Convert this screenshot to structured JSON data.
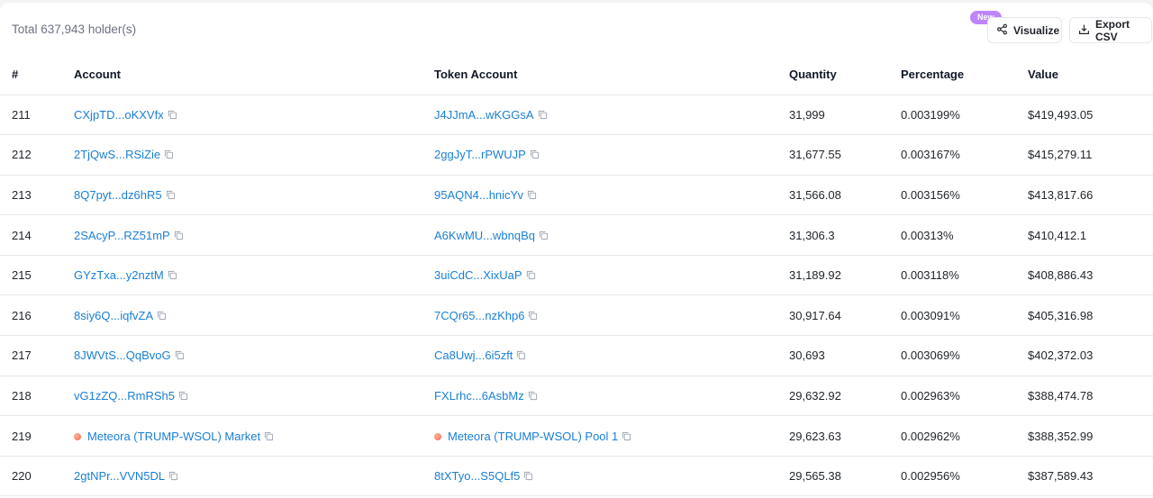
{
  "header": {
    "total_label": "Total 637,943 holder(s)",
    "new_badge": "New",
    "visualize_label": "Visualize",
    "export_label": "Export CSV"
  },
  "table": {
    "columns": [
      "#",
      "Account",
      "Token Account",
      "Quantity",
      "Percentage",
      "Value"
    ],
    "rows": [
      {
        "idx": "211",
        "account": "CXjpTD...oKXVfx",
        "account_protocol": false,
        "token": "J4JJmA...wKGGsA",
        "token_protocol": false,
        "qty": "31,999",
        "pct": "0.003199%",
        "value": "$419,493.05"
      },
      {
        "idx": "212",
        "account": "2TjQwS...RSiZie",
        "account_protocol": false,
        "token": "2ggJyT...rPWUJP",
        "token_protocol": false,
        "qty": "31,677.55",
        "pct": "0.003167%",
        "value": "$415,279.11"
      },
      {
        "idx": "213",
        "account": "8Q7pyt...dz6hR5",
        "account_protocol": false,
        "token": "95AQN4...hnicYv",
        "token_protocol": false,
        "qty": "31,566.08",
        "pct": "0.003156%",
        "value": "$413,817.66"
      },
      {
        "idx": "214",
        "account": "2SAcyP...RZ51mP",
        "account_protocol": false,
        "token": "A6KwMU...wbnqBq",
        "token_protocol": false,
        "qty": "31,306.3",
        "pct": "0.00313%",
        "value": "$410,412.1"
      },
      {
        "idx": "215",
        "account": "GYzTxa...y2nztM",
        "account_protocol": false,
        "token": "3uiCdC...XixUaP",
        "token_protocol": false,
        "qty": "31,189.92",
        "pct": "0.003118%",
        "value": "$408,886.43"
      },
      {
        "idx": "216",
        "account": "8siy6Q...iqfvZA",
        "account_protocol": false,
        "token": "7CQr65...nzKhp6",
        "token_protocol": false,
        "qty": "30,917.64",
        "pct": "0.003091%",
        "value": "$405,316.98"
      },
      {
        "idx": "217",
        "account": "8JWVtS...QqBvoG",
        "account_protocol": false,
        "token": "Ca8Uwj...6i5zft",
        "token_protocol": false,
        "qty": "30,693",
        "pct": "0.003069%",
        "value": "$402,372.03"
      },
      {
        "idx": "218",
        "account": "vG1zZQ...RmRSh5",
        "account_protocol": false,
        "token": "FXLrhc...6AsbMz",
        "token_protocol": false,
        "qty": "29,632.92",
        "pct": "0.002963%",
        "value": "$388,474.78"
      },
      {
        "idx": "219",
        "account": "Meteora (TRUMP-WSOL) Market",
        "account_protocol": true,
        "token": "Meteora (TRUMP-WSOL) Pool 1",
        "token_protocol": true,
        "qty": "29,623.63",
        "pct": "0.002962%",
        "value": "$388,352.99"
      },
      {
        "idx": "220",
        "account": "2gtNPr...VVN5DL",
        "account_protocol": false,
        "token": "8tXTyo...S5QLf5",
        "token_protocol": false,
        "qty": "29,565.38",
        "pct": "0.002956%",
        "value": "$387,589.43"
      }
    ]
  },
  "colors": {
    "link": "#1a7fd6",
    "badge": "#c084fc",
    "protocol_dot": "#f06a4a"
  },
  "icons": {
    "visualize": "share-nodes-icon",
    "export": "download-tray-icon",
    "copy": "copy-icon",
    "protocol": "meteora-logo-icon"
  }
}
